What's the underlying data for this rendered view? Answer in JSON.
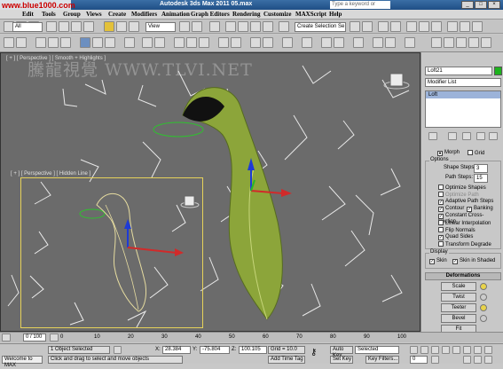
{
  "window": {
    "title": "Autodesk 3ds Max  2011      05.max"
  },
  "search": {
    "placeholder": "Type a keyword or phrase"
  },
  "menu": [
    "Edit",
    "Tools",
    "Group",
    "Views",
    "Create",
    "Modifiers",
    "Animation",
    "Graph Editors",
    "Rendering",
    "Customize",
    "MAXScript",
    "Help"
  ],
  "toolbar": {
    "selection_filter": "All",
    "ref_coord": "View",
    "named_selection": "Create Selection Se"
  },
  "watermark": {
    "site_badge": "www.blue1000.com",
    "text": "騰龍視覺 WWW.TLVI.NET"
  },
  "viewports": {
    "main_label": "[ + ] [ Perspective ] [ Smooth + Highlights ]",
    "sub_label": "[ + ] [ Perspective ] [ Hidden Line ]"
  },
  "command_panel": {
    "object_name": "Loft21",
    "modifier_list": "Modifier List",
    "stack_item": "Loft",
    "surface_params": {
      "morph": "Morph",
      "grid": "Grid"
    },
    "options_title": "Options",
    "shape_steps_label": "Shape Steps:",
    "shape_steps": "3",
    "path_steps_label": "Path Steps:",
    "path_steps": "15",
    "checks": [
      {
        "label": "Optimize Shapes",
        "checked": false
      },
      {
        "label": "Optimize Path",
        "checked": false
      },
      {
        "label": "Adaptive Path Steps",
        "checked": true
      },
      {
        "label": "Contour",
        "checked": true,
        "extra": "Banking",
        "extra_checked": true
      },
      {
        "label": "Constant Cross-Section",
        "checked": true
      },
      {
        "label": "Linear Interpolation",
        "checked": false
      },
      {
        "label": "Flip Normals",
        "checked": false
      },
      {
        "label": "Quad Sides",
        "checked": true
      },
      {
        "label": "Transform Degrade",
        "checked": false
      }
    ],
    "display_title": "Display",
    "display_skin": "Skin",
    "display_skin_shaded": "Skin in Shaded",
    "deformations_title": "Deformations",
    "deform_buttons": [
      "Scale",
      "Twist",
      "Teeter",
      "Bevel",
      "Fit"
    ]
  },
  "timeline": {
    "frame": "0 / 100",
    "ticks": [
      "0",
      "10",
      "20",
      "30",
      "40",
      "50",
      "60",
      "70",
      "80",
      "90",
      "100"
    ]
  },
  "status": {
    "selection": "1 Object Selected",
    "prompt": "Click and drag to select and move objects",
    "welcome": "Welcome to MAX",
    "x_label": "X:",
    "x": "28.384",
    "y_label": "Y:",
    "y": "-75.804",
    "z_label": "Z:",
    "z": "100.105",
    "grid": "Grid = 10.0",
    "add_time_tag": "Add Time Tag",
    "auto_key": "Auto Key",
    "set_key": "Set Key",
    "selected": "Selected",
    "key_filters": "Key Filters...",
    "frame_field": "0"
  }
}
